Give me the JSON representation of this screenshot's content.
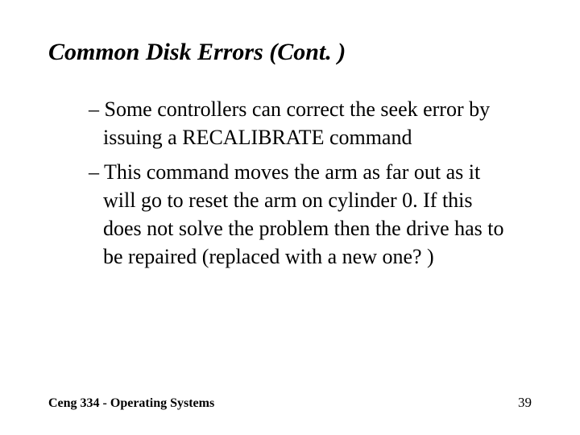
{
  "slide": {
    "title": "Common Disk Errors (Cont. )",
    "bullets": [
      "– Some controllers can correct the seek error by issuing a RECALIBRATE command",
      "– This command moves the arm as far out as it will go to reset the arm on cylinder 0. If this does not solve the problem then the drive has to be repaired (replaced with a new one? )"
    ],
    "footer_left": "Ceng 334 - Operating Systems",
    "footer_right": "39"
  }
}
